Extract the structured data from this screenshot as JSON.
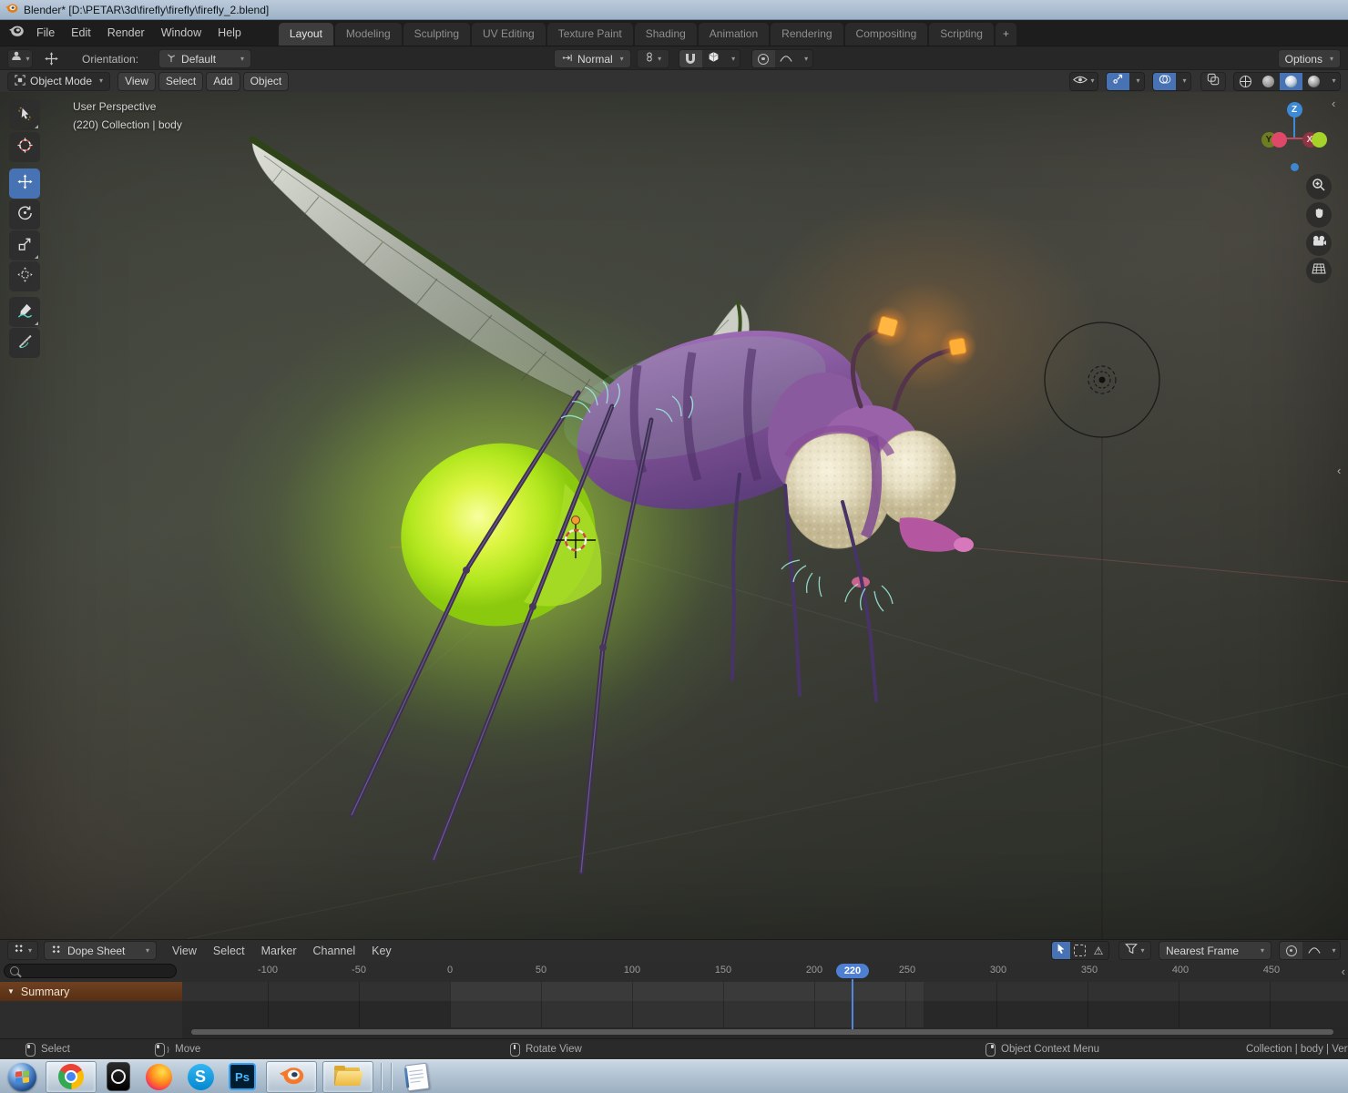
{
  "titlebar": {
    "title": "Blender* [D:\\PETAR\\3d\\firefly\\firefly\\firefly_2.blend]"
  },
  "menubar": {
    "menus": [
      "File",
      "Edit",
      "Render",
      "Window",
      "Help"
    ],
    "tabs": [
      {
        "label": "Layout",
        "active": true
      },
      {
        "label": "Modeling"
      },
      {
        "label": "Sculpting"
      },
      {
        "label": "UV Editing"
      },
      {
        "label": "Texture Paint"
      },
      {
        "label": "Shading"
      },
      {
        "label": "Animation"
      },
      {
        "label": "Rendering"
      },
      {
        "label": "Compositing"
      },
      {
        "label": "Scripting"
      },
      {
        "label": "+"
      }
    ]
  },
  "tool_settings": {
    "orientation_label": "Orientation:",
    "orientation_value": "Default",
    "snap_mode": "Normal",
    "options_label": "Options"
  },
  "viewport_header": {
    "mode": "Object Mode",
    "menus": [
      "View",
      "Select",
      "Add",
      "Object"
    ]
  },
  "viewport": {
    "overlay_line1": "User Perspective",
    "overlay_line2": "(220) Collection | body",
    "axis": {
      "x": "X",
      "y": "Y",
      "z": "Z"
    }
  },
  "dope_sheet": {
    "editor": "Dope Sheet",
    "menus": [
      "View",
      "Select",
      "Marker",
      "Channel",
      "Key"
    ],
    "snap": "Nearest Frame",
    "channel": "Summary",
    "current_frame": "220",
    "ruler": [
      "-100",
      "-50",
      "0",
      "50",
      "100",
      "150",
      "200",
      "250",
      "300",
      "350",
      "400",
      "450"
    ]
  },
  "status_bar": {
    "hints": [
      "Select",
      "Move",
      "Rotate View",
      "Object Context Menu"
    ],
    "context": "Collection | body | Vert"
  },
  "taskbar": {
    "photoshop_label": "Ps",
    "skype_label": "S"
  },
  "icons": {
    "chevron_down": "▾",
    "warning": "⚠",
    "triangle_down": "▼",
    "collapse_left": "‹"
  },
  "colors": {
    "accent_blue": "#4772b3",
    "frame_badge": "#4f7fd0",
    "glow_green": "#c8f22e",
    "glow_orange": "#ffa23a",
    "summary_brown": "#6b3d1d"
  }
}
